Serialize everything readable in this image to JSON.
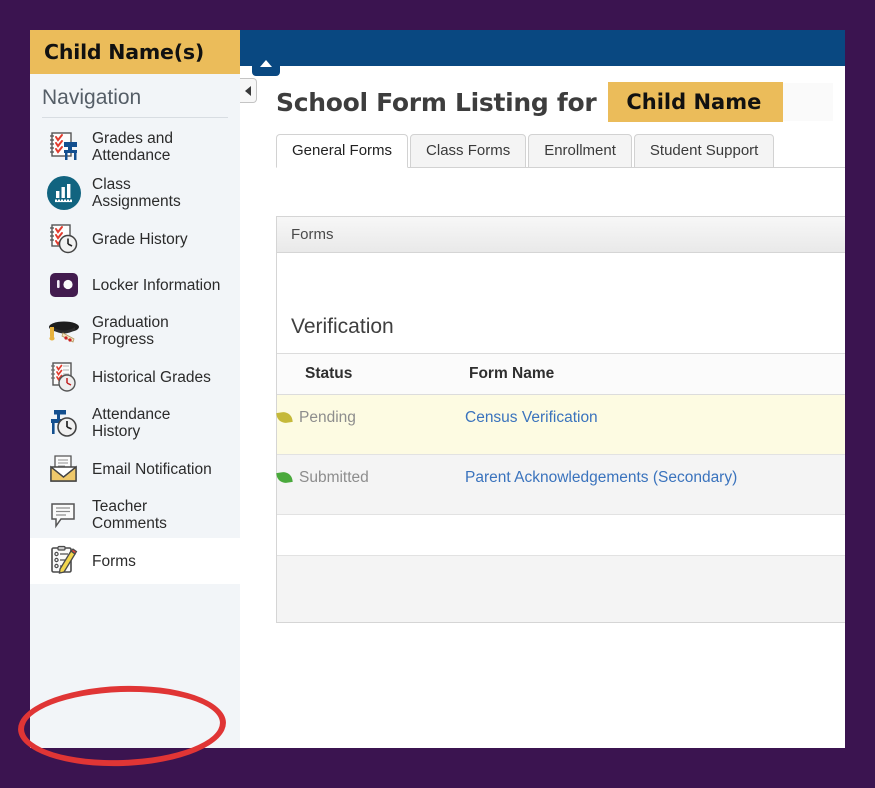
{
  "theme": {
    "page_background": "#3b1450",
    "header_bar": "#094881",
    "accent_yellow": "#ebbc5a",
    "sidebar_background": "#f2f5f8",
    "link_color": "#3a73bd",
    "annotation_color": "#e03535"
  },
  "sidebar": {
    "student_name": "Child Name(s)",
    "nav_title": "Navigation",
    "items": [
      {
        "label": "Grades and Attendance",
        "icon": "grades-attendance-icon",
        "selected": false
      },
      {
        "label": "Class Assignments",
        "icon": "class-assignments-icon",
        "selected": false
      },
      {
        "label": "Grade History",
        "icon": "grade-history-icon",
        "selected": false
      },
      {
        "label": "Locker Information",
        "icon": "locker-information-icon",
        "selected": false
      },
      {
        "label": "Graduation Progress",
        "icon": "graduation-cap-icon",
        "selected": false
      },
      {
        "label": "Historical Grades",
        "icon": "historical-grades-icon",
        "selected": false
      },
      {
        "label": "Attendance History",
        "icon": "attendance-history-icon",
        "selected": false
      },
      {
        "label": "Email Notification",
        "icon": "email-notification-icon",
        "selected": false
      },
      {
        "label": "Teacher Comments",
        "icon": "teacher-comments-icon",
        "selected": false
      },
      {
        "label": "Forms",
        "icon": "forms-icon",
        "selected": true
      }
    ]
  },
  "main": {
    "collapse_tab_icon": "triangle-up-icon",
    "side_toggle_icon": "triangle-left-icon",
    "page_title": "School Form Listing for",
    "student_chip": "Child Name",
    "tabs": [
      {
        "label": "General Forms",
        "active": true
      },
      {
        "label": "Class Forms",
        "active": false
      },
      {
        "label": "Enrollment",
        "active": false
      },
      {
        "label": "Student Support",
        "active": false
      }
    ],
    "panel": {
      "header": "Forms",
      "section_title": "Verification",
      "columns": [
        "Status",
        "Form Name"
      ],
      "rows": [
        {
          "status": "Pending",
          "status_icon": "leaf-icon-yellow",
          "form_name": "Census Verification"
        },
        {
          "status": "Submitted",
          "status_icon": "leaf-icon-green",
          "form_name": "Parent Acknowledgements (Secondary)"
        }
      ]
    }
  },
  "annotation": {
    "shape": "red-ellipse-highlight",
    "target": "Forms"
  }
}
